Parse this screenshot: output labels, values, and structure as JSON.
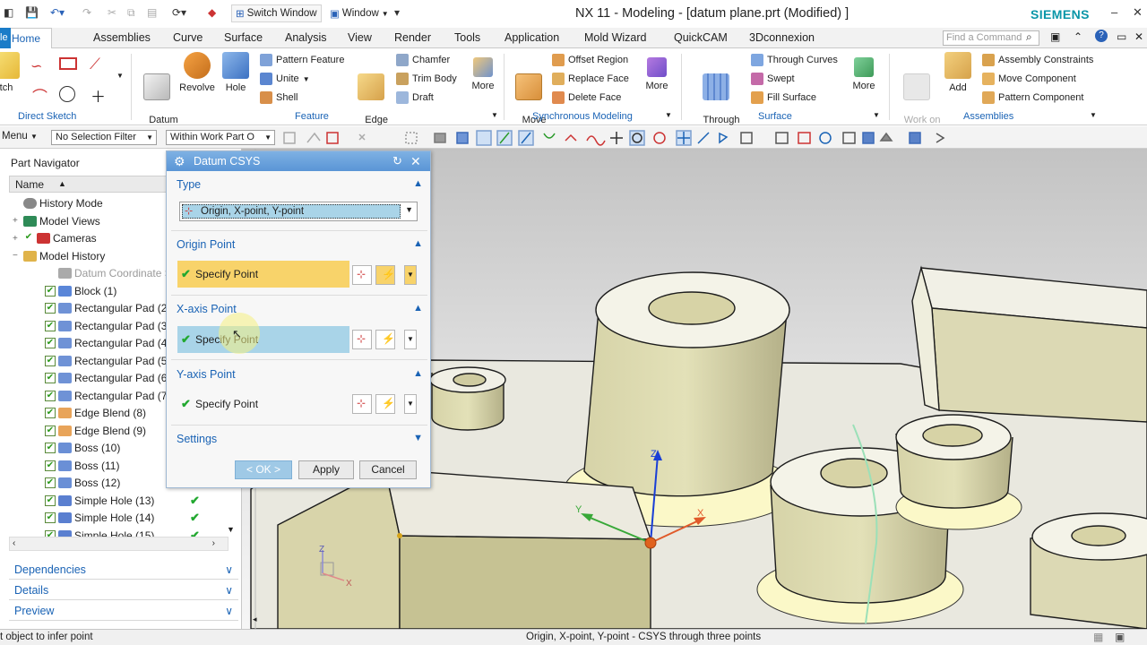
{
  "titlebar": {
    "switch_window": "Switch Window",
    "window_menu": "Window",
    "title": "NX 11 - Modeling - [datum plane.prt (Modified) ]",
    "brand": "SIEMENS"
  },
  "tabs": {
    "file_stub": "le",
    "items": [
      "Home",
      "Assemblies",
      "Curve",
      "Surface",
      "Analysis",
      "View",
      "Render",
      "Tools",
      "Application",
      "Mold Wizard",
      "QuickCAM",
      "3Dconnexion"
    ],
    "find_command_placeholder": "Find a Command"
  },
  "ribbon": {
    "sketch_stub": "tch",
    "direct_sketch": "Direct Sketch",
    "datum_csys": "Datum\nCSYS",
    "revolve": "Revolve",
    "hole": "Hole",
    "pattern_feature": "Pattern Feature",
    "unite": "Unite",
    "shell": "Shell",
    "edge_blend": "Edge\nBlend",
    "chamfer": "Chamfer",
    "trim_body": "Trim Body",
    "draft": "Draft",
    "more": "More",
    "feature": "Feature",
    "move_face": "Move\nFace",
    "offset_region": "Offset Region",
    "replace_face": "Replace Face",
    "delete_face": "Delete Face",
    "synchronous_modeling": "Synchronous Modeling",
    "through_curve_mesh": "Through\nCurve Mesh",
    "through_curves": "Through Curves",
    "swept": "Swept",
    "fill_surface": "Fill Surface",
    "surface": "Surface",
    "work_on_assembly": "Work on\nAssembly",
    "add": "Add",
    "assembly_constraints": "Assembly Constraints",
    "move_component": "Move Component",
    "pattern_component": "Pattern Component",
    "assemblies": "Assemblies"
  },
  "selbar": {
    "menu": "Menu",
    "filter": "No Selection Filter",
    "scope": "Within Work Part O"
  },
  "navigator": {
    "title": "Part Navigator",
    "col_name": "Name",
    "rows": [
      {
        "label": "History Mode",
        "type": "root"
      },
      {
        "label": "Model Views",
        "type": "root"
      },
      {
        "label": "Cameras",
        "type": "root"
      },
      {
        "label": "Model History",
        "type": "root"
      },
      {
        "label": "Datum Coordinate S",
        "type": "datum"
      },
      {
        "label": "Block (1)",
        "type": "feat"
      },
      {
        "label": "Rectangular Pad (2)",
        "type": "feat"
      },
      {
        "label": "Rectangular Pad (3)",
        "type": "feat"
      },
      {
        "label": "Rectangular Pad (4)",
        "type": "feat"
      },
      {
        "label": "Rectangular Pad (5)",
        "type": "feat"
      },
      {
        "label": "Rectangular Pad (6)",
        "type": "feat"
      },
      {
        "label": "Rectangular Pad (7)",
        "type": "feat"
      },
      {
        "label": "Edge Blend (8)",
        "type": "feat"
      },
      {
        "label": "Edge Blend (9)",
        "type": "feat"
      },
      {
        "label": "Boss (10)",
        "type": "feat"
      },
      {
        "label": "Boss (11)",
        "type": "feat"
      },
      {
        "label": "Boss (12)",
        "type": "feat"
      },
      {
        "label": "Simple Hole (13)",
        "type": "feat"
      },
      {
        "label": "Simple Hole (14)",
        "type": "feat"
      },
      {
        "label": "Simple Hole (15)",
        "type": "feat"
      }
    ],
    "sections": [
      "Dependencies",
      "Details",
      "Preview"
    ]
  },
  "dialog": {
    "title": "Datum CSYS",
    "type_label": "Type",
    "type_value": "Origin, X-point, Y-point",
    "origin_point": "Origin Point",
    "x_axis_point": "X-axis Point",
    "y_axis_point": "Y-axis Point",
    "specify_point": "Specify Point",
    "settings": "Settings",
    "ok": "< OK >",
    "apply": "Apply",
    "cancel": "Cancel"
  },
  "viewport": {
    "triad_z": "Z",
    "triad_y": "Y",
    "triad_x": "X"
  },
  "status": {
    "left": "t object to infer point",
    "center": "Origin, X-point, Y-point - CSYS through three points"
  }
}
